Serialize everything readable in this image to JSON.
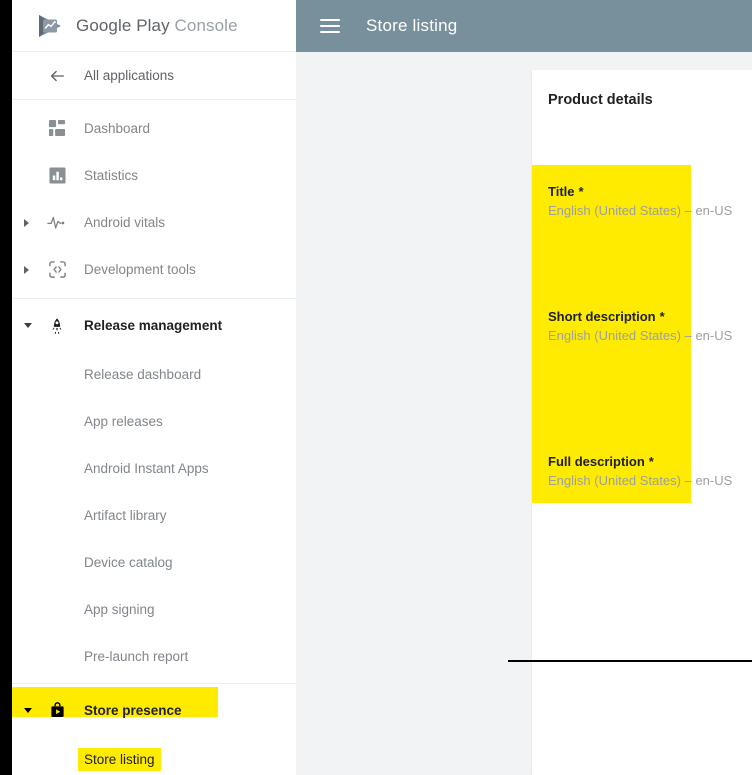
{
  "brand": {
    "name_primary": "Google Play",
    "name_secondary": "Console",
    "logo_icon": "google-play-console-logo"
  },
  "topbar": {
    "menu_icon": "hamburger-menu-icon",
    "title": "Store listing"
  },
  "sidebar": {
    "back_item": {
      "label": "All applications",
      "icon": "arrow-left-icon"
    },
    "items": [
      {
        "label": "Dashboard",
        "icon": "dashboard-grid-icon",
        "expandable": false,
        "expanded": false,
        "active": false,
        "highlighted": false
      },
      {
        "label": "Statistics",
        "icon": "bar-chart-icon",
        "expandable": false,
        "expanded": false,
        "active": false,
        "highlighted": false
      },
      {
        "label": "Android vitals",
        "icon": "heartbeat-pulse-icon",
        "expandable": true,
        "expanded": false,
        "active": false,
        "highlighted": false
      },
      {
        "label": "Development tools",
        "icon": "code-brackets-icon",
        "expandable": true,
        "expanded": false,
        "active": false,
        "highlighted": false
      },
      {
        "label": "Release management",
        "icon": "rocket-icon",
        "expandable": true,
        "expanded": true,
        "active": true,
        "highlighted": false
      }
    ],
    "release_sub_items": [
      {
        "label": "Release dashboard"
      },
      {
        "label": "App releases"
      },
      {
        "label": "Android Instant Apps"
      },
      {
        "label": "Artifact library"
      },
      {
        "label": "Device catalog"
      },
      {
        "label": "App signing"
      },
      {
        "label": "Pre-launch report"
      }
    ],
    "store_presence": {
      "label": "Store presence",
      "icon": "shopping-bag-play-icon",
      "expandable": true,
      "expanded": true,
      "highlighted": true
    },
    "store_presence_sub_items": [
      {
        "label": "Store listing",
        "highlighted": true
      }
    ]
  },
  "main": {
    "card_title": "Product details",
    "fields": [
      {
        "label": "Title",
        "required_marker": "*",
        "locale": "English (United States)",
        "separator": "–",
        "locale_code": "en-US"
      },
      {
        "label": "Short description",
        "required_marker": "*",
        "locale": "English (United States)",
        "separator": "–",
        "locale_code": "en-US"
      },
      {
        "label": "Full description",
        "required_marker": "*",
        "locale": "English (United States)",
        "separator": "–",
        "locale_code": "en-US"
      }
    ]
  },
  "colors": {
    "topbar_bg": "#78909c",
    "highlight_yellow": "#ffeb00",
    "content_bg": "#f1f3f4",
    "text_primary": "#202124",
    "text_secondary": "#80868b",
    "text_muted": "#9aa0a6"
  }
}
